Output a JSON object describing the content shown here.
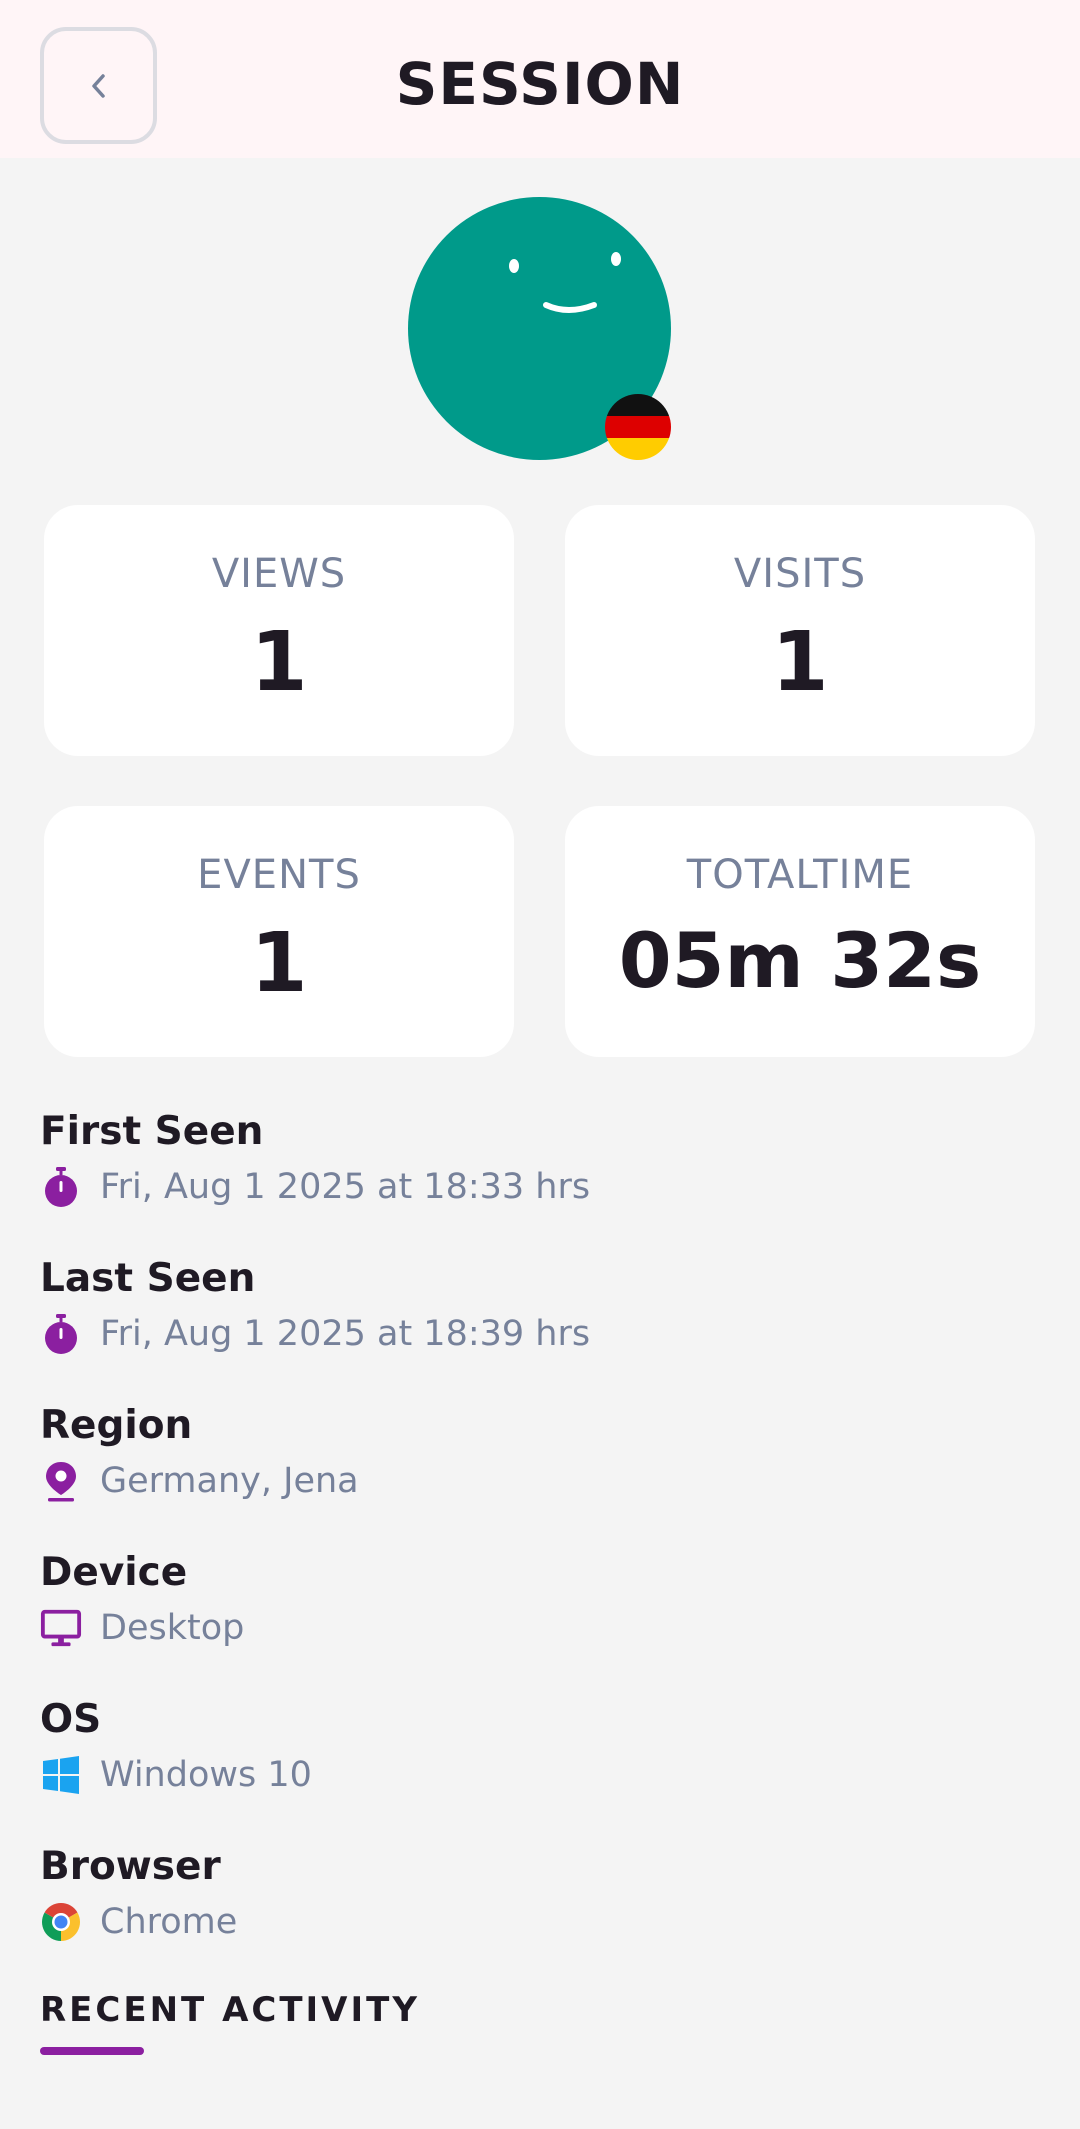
{
  "header": {
    "title": "SESSION"
  },
  "stats": [
    {
      "label": "VIEWS",
      "value": "1"
    },
    {
      "label": "VISITS",
      "value": "1"
    },
    {
      "label": "EVENTS",
      "value": "1"
    },
    {
      "label": "TOTALTIME",
      "value": "05m 32s"
    }
  ],
  "details": {
    "first_seen": {
      "label": "First Seen",
      "value": "Fri, Aug 1 2025 at 18:33 hrs",
      "icon": "stopwatch-icon"
    },
    "last_seen": {
      "label": "Last Seen",
      "value": "Fri, Aug 1 2025 at 18:39 hrs",
      "icon": "stopwatch-icon"
    },
    "region": {
      "label": "Region",
      "value": "Germany, Jena",
      "icon": "location-pin-icon"
    },
    "device": {
      "label": "Device",
      "value": "Desktop",
      "icon": "monitor-icon"
    },
    "os": {
      "label": "OS",
      "value": "Windows 10",
      "icon": "windows-icon"
    },
    "browser": {
      "label": "Browser",
      "value": "Chrome",
      "icon": "chrome-icon"
    }
  },
  "recent_activity": {
    "title": "RECENT ACTIVITY"
  },
  "colors": {
    "accent": "#8b1fa0",
    "avatar": "#009a8a",
    "header_bg": "#fff5f7",
    "muted_text": "#76819a",
    "windows_blue": "#1aa3f0"
  }
}
